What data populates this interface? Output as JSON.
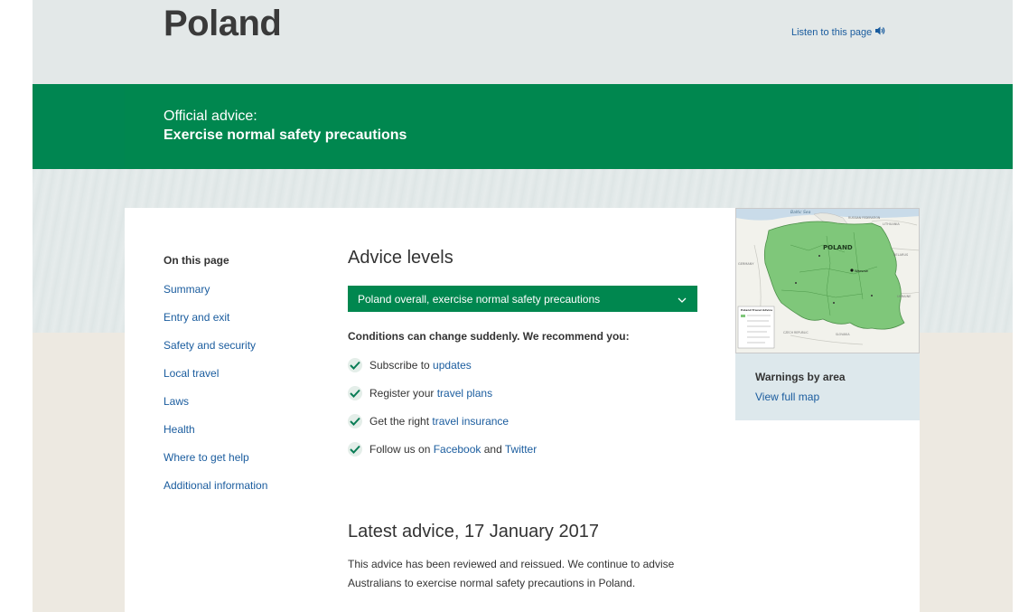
{
  "header": {
    "title": "Poland",
    "listen_label": "Listen to this page"
  },
  "advice": {
    "label": "Official advice:",
    "level": "Exercise normal safety precautions"
  },
  "on_this_page": {
    "heading": "On this page",
    "items": [
      "Summary",
      "Entry and exit",
      "Safety and security",
      "Local travel",
      "Laws",
      "Health",
      "Where to get help",
      "Additional information"
    ]
  },
  "advice_levels": {
    "heading": "Advice levels",
    "selected": "Poland overall, exercise normal safety precautions",
    "conditions": "Conditions can change suddenly. We recommend you:",
    "recommendations": [
      {
        "text": "Subscribe to ",
        "link": "updates"
      },
      {
        "text": "Register your ",
        "link": "travel plans"
      },
      {
        "text": "Get the right ",
        "link": "travel insurance"
      },
      {
        "text": "Follow us on ",
        "link": "Facebook",
        "middle": " and ",
        "link2": "Twitter"
      }
    ]
  },
  "latest": {
    "heading": "Latest advice, 17 January 2017",
    "body": "This advice has been reviewed and reissued. We continue to advise Australians to exercise normal safety precautions in Poland."
  },
  "map": {
    "sea_label": "Baltic Sea",
    "country_label": "POLAND",
    "capital_label": "Warsaw",
    "neighbors": [
      "RUSSIAN FEDERATION",
      "LITHUANIA",
      "BELARUS",
      "UKRAINE",
      "GERMANY",
      "CZECH REPUBLIC",
      "SLOVAKIA"
    ],
    "legend_title": "Poland Travel Advice",
    "colors": {
      "land": "#7fc77a",
      "neighbor": "#f2f2ec",
      "water": "#c9dbe9"
    }
  },
  "warnings": {
    "title": "Warnings by area",
    "link": "View full map"
  },
  "colors": {
    "green": "#00874f",
    "link": "#1a5c9e",
    "text": "#333333"
  }
}
